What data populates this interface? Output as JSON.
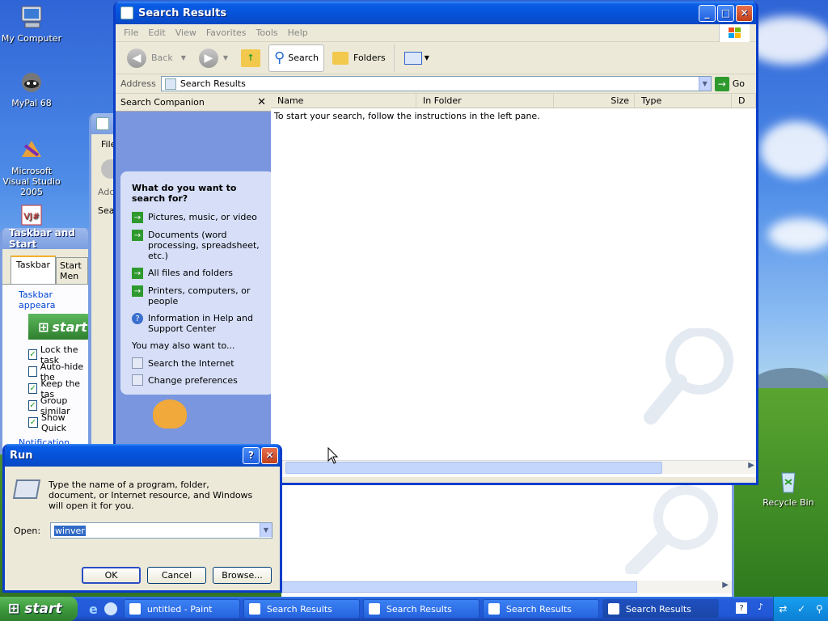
{
  "desktop": {
    "icons": [
      {
        "label": "My Computer",
        "icon": "my-computer-icon"
      },
      {
        "label": "MyPal 68",
        "icon": "mypal-icon"
      },
      {
        "label": "Microsoft Visual Studio 2005",
        "icon": "visual-studio-icon"
      },
      {
        "label": "Recycle Bin",
        "icon": "recycle-bin-icon"
      }
    ]
  },
  "search_window": {
    "title": "Search Results",
    "menu": [
      "File",
      "Edit",
      "View",
      "Favorites",
      "Tools",
      "Help"
    ],
    "toolbar": {
      "back": "Back",
      "search": "Search",
      "folders": "Folders"
    },
    "address": {
      "label": "Address",
      "value": "Search Results",
      "go": "Go"
    },
    "companion": {
      "header": "Search Companion",
      "question": "What do you want to search for?",
      "options": [
        "Pictures, music, or video",
        "Documents (word processing, spreadsheet, etc.)",
        "All files and folders",
        "Printers, computers, or people",
        "Information in Help and Support Center"
      ],
      "also_label": "You may also want to...",
      "also": [
        "Search the Internet",
        "Change preferences"
      ]
    },
    "columns": [
      "Name",
      "In Folder",
      "Size",
      "Type",
      "D"
    ],
    "empty_message": "To start your search, follow the instructions in the left pane."
  },
  "back_window": {
    "menu_first": "File",
    "address_first": "Add",
    "search_first": "Sear"
  },
  "taskbar_props": {
    "title": "Taskbar and Start",
    "tabs": [
      "Taskbar",
      "Start Men"
    ],
    "section1": "Taskbar appeara",
    "start_label": "start",
    "checks": [
      {
        "label": "Lock the task",
        "checked": true
      },
      {
        "label": "Auto-hide the",
        "checked": false
      },
      {
        "label": "Keep the tas",
        "checked": true
      },
      {
        "label": "Group similar",
        "checked": true
      },
      {
        "label": "Show Quick",
        "checked": true
      }
    ],
    "section2": "Notification area"
  },
  "run_dialog": {
    "title": "Run",
    "description": "Type the name of a program, folder, document, or Internet resource, and Windows will open it for you.",
    "open_label": "Open:",
    "open_value": "winver",
    "ok": "OK",
    "cancel": "Cancel",
    "browse": "Browse..."
  },
  "taskbar": {
    "start": "start",
    "items": [
      {
        "label": "untitled - Paint",
        "active": false
      },
      {
        "label": "Search Results",
        "active": false
      },
      {
        "label": "Search Results",
        "active": false
      },
      {
        "label": "Search Results",
        "active": false
      },
      {
        "label": "Search Results",
        "active": true
      }
    ]
  }
}
